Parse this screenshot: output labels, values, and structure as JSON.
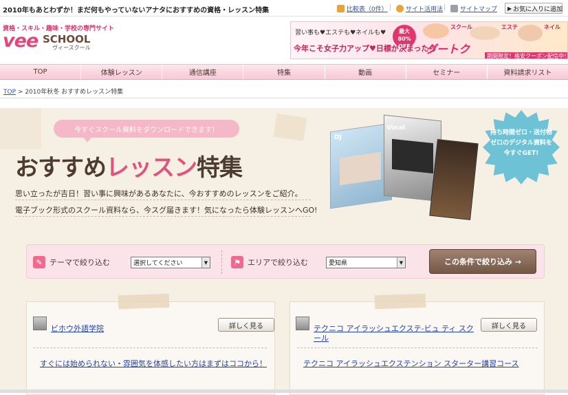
{
  "topbar": {
    "title": "2010年もあとわずか！まだ何もやっていないアナタにおすすめの資格・レッスン特集",
    "links": [
      {
        "label": "比較表（0件）",
        "icon": "compare-icon",
        "color": "#e8a33a"
      },
      {
        "label": "サイト活用法",
        "icon": "question-icon",
        "color": "#e8a33a"
      },
      {
        "label": "サイトマップ",
        "icon": "sitemap-icon",
        "color": "#9aa0a8"
      }
    ],
    "separator": "|",
    "favorite_label": "お気に入りに追加"
  },
  "logo": {
    "tagline": "資格・スキル・趣味・学校の専門サイト",
    "brand_vee": "vee",
    "brand_school": "SCHOOL",
    "brand_kana": "ヴィースクール"
  },
  "banner": {
    "line1": "習い事も♥エステも♥ネイルも♥",
    "line2": "今年こそ女子力アップ♥日標が決まったら",
    "discount": "最大 80% OFF",
    "brand": "グートク",
    "badge": "期間限定！格安クーポン配信中！",
    "tags": [
      "スクール",
      "エステ",
      "ネイル"
    ]
  },
  "nav": {
    "items": [
      "TOP",
      "体験レッスン",
      "通信講座",
      "特集",
      "動画",
      "セミナー",
      "資料請求リスト"
    ]
  },
  "breadcrumb": {
    "home": "TOP",
    "sep": ">",
    "current": "2010年秋冬 おすすめレッスン特集"
  },
  "hero": {
    "bubble": "今すぐスクール資料をダウンロードできます！",
    "title_prefix": "おすすめ",
    "title_accent": "レッスン",
    "title_suffix": "特集",
    "desc1": "思い立ったが吉日！習い事に興味があるあなたに、今おすすめのレッスンをご紹介。",
    "desc2": "電子ブック形式のスクール資料なら、今スグ届きます！気になったら体験レッスンへGO!",
    "starburst": "持ち時間ゼロ・送付物ゼロのデジタル資料を今すぐGET!"
  },
  "catalog": {
    "tags": [
      "DJ",
      "Vocal"
    ]
  },
  "filter": {
    "theme_label": "テーマで絞り込む",
    "theme_value": "選択してください",
    "area_label": "エリアで絞り込む",
    "area_value": "愛知県",
    "submit_label": "この条件で絞り込み →",
    "accent": "#f06a8f"
  },
  "cards": [
    {
      "school": "ビホウ外語学院",
      "detail_label": "詳しく見る",
      "lesson": "すぐには始められない・雰囲気を体感したい方はまずはココから！"
    },
    {
      "school": "テクニコ アイラッシュエクステ-ビュ ティ スクール",
      "detail_label": "詳しく見る",
      "lesson": "テクニコ アイラッシュエクステンション スターター講習コース"
    }
  ],
  "colors": {
    "brand_pink": "#e2457a",
    "brand_brown": "#6b4a38",
    "hero_bg": "#f6efe4",
    "nav_bg": "#fbdbe3"
  }
}
